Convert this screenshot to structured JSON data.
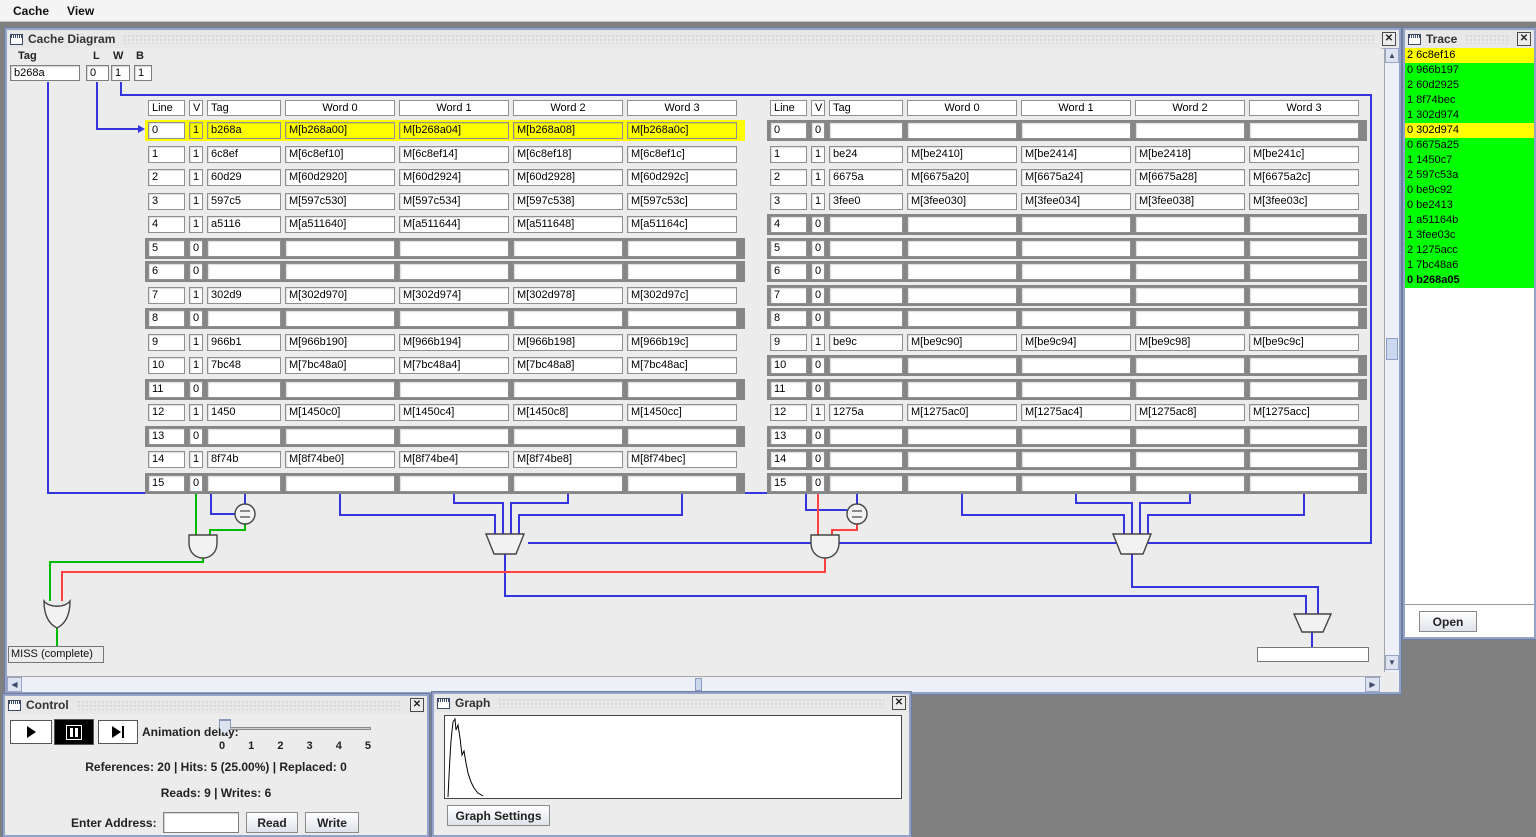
{
  "menu": {
    "items": [
      {
        "label": "Cache"
      },
      {
        "label": "View"
      }
    ]
  },
  "cache_frame": {
    "title": "Cache Diagram",
    "address_fields": {
      "tag_label": "Tag",
      "tag_value": "b268a",
      "line_label": "L",
      "line_value": "0",
      "word_label": "W",
      "word_value": "1",
      "byte_label": "B",
      "byte_value": "1"
    },
    "column_headers": [
      "Line",
      "V",
      "Tag",
      "Word 0",
      "Word 1",
      "Word 2",
      "Word 3"
    ],
    "ways": [
      {
        "rows": [
          {
            "line": "0",
            "v": "1",
            "tag": "b268a",
            "words": [
              "M[b268a00]",
              "M[b268a04]",
              "M[b268a08]",
              "M[b268a0c]"
            ],
            "state": "hit"
          },
          {
            "line": "1",
            "v": "1",
            "tag": "6c8ef",
            "words": [
              "M[6c8ef10]",
              "M[6c8ef14]",
              "M[6c8ef18]",
              "M[6c8ef1c]"
            ],
            "state": "valid"
          },
          {
            "line": "2",
            "v": "1",
            "tag": "60d29",
            "words": [
              "M[60d2920]",
              "M[60d2924]",
              "M[60d2928]",
              "M[60d292c]"
            ],
            "state": "valid"
          },
          {
            "line": "3",
            "v": "1",
            "tag": "597c5",
            "words": [
              "M[597c530]",
              "M[597c534]",
              "M[597c538]",
              "M[597c53c]"
            ],
            "state": "valid"
          },
          {
            "line": "4",
            "v": "1",
            "tag": "a5116",
            "words": [
              "M[a511640]",
              "M[a511644]",
              "M[a511648]",
              "M[a51164c]"
            ],
            "state": "valid"
          },
          {
            "line": "5",
            "v": "0",
            "tag": "",
            "words": [
              "",
              "",
              "",
              ""
            ],
            "state": "empty"
          },
          {
            "line": "6",
            "v": "0",
            "tag": "",
            "words": [
              "",
              "",
              "",
              ""
            ],
            "state": "empty"
          },
          {
            "line": "7",
            "v": "1",
            "tag": "302d9",
            "words": [
              "M[302d970]",
              "M[302d974]",
              "M[302d978]",
              "M[302d97c]"
            ],
            "state": "valid"
          },
          {
            "line": "8",
            "v": "0",
            "tag": "",
            "words": [
              "",
              "",
              "",
              ""
            ],
            "state": "empty"
          },
          {
            "line": "9",
            "v": "1",
            "tag": "966b1",
            "words": [
              "M[966b190]",
              "M[966b194]",
              "M[966b198]",
              "M[966b19c]"
            ],
            "state": "valid"
          },
          {
            "line": "10",
            "v": "1",
            "tag": "7bc48",
            "words": [
              "M[7bc48a0]",
              "M[7bc48a4]",
              "M[7bc48a8]",
              "M[7bc48ac]"
            ],
            "state": "valid"
          },
          {
            "line": "11",
            "v": "0",
            "tag": "",
            "words": [
              "",
              "",
              "",
              ""
            ],
            "state": "empty"
          },
          {
            "line": "12",
            "v": "1",
            "tag": "1450",
            "words": [
              "M[1450c0]",
              "M[1450c4]",
              "M[1450c8]",
              "M[1450cc]"
            ],
            "state": "valid"
          },
          {
            "line": "13",
            "v": "0",
            "tag": "",
            "words": [
              "",
              "",
              "",
              ""
            ],
            "state": "empty"
          },
          {
            "line": "14",
            "v": "1",
            "tag": "8f74b",
            "words": [
              "M[8f74be0]",
              "M[8f74be4]",
              "M[8f74be8]",
              "M[8f74bec]"
            ],
            "state": "valid"
          },
          {
            "line": "15",
            "v": "0",
            "tag": "",
            "words": [
              "",
              "",
              "",
              ""
            ],
            "state": "empty"
          }
        ]
      },
      {
        "rows": [
          {
            "line": "0",
            "v": "0",
            "tag": "",
            "words": [
              "",
              "",
              "",
              ""
            ],
            "state": "empty"
          },
          {
            "line": "1",
            "v": "1",
            "tag": "be24",
            "words": [
              "M[be2410]",
              "M[be2414]",
              "M[be2418]",
              "M[be241c]"
            ],
            "state": "valid"
          },
          {
            "line": "2",
            "v": "1",
            "tag": "6675a",
            "words": [
              "M[6675a20]",
              "M[6675a24]",
              "M[6675a28]",
              "M[6675a2c]"
            ],
            "state": "valid"
          },
          {
            "line": "3",
            "v": "1",
            "tag": "3fee0",
            "words": [
              "M[3fee030]",
              "M[3fee034]",
              "M[3fee038]",
              "M[3fee03c]"
            ],
            "state": "valid"
          },
          {
            "line": "4",
            "v": "0",
            "tag": "",
            "words": [
              "",
              "",
              "",
              ""
            ],
            "state": "empty"
          },
          {
            "line": "5",
            "v": "0",
            "tag": "",
            "words": [
              "",
              "",
              "",
              ""
            ],
            "state": "empty"
          },
          {
            "line": "6",
            "v": "0",
            "tag": "",
            "words": [
              "",
              "",
              "",
              ""
            ],
            "state": "empty"
          },
          {
            "line": "7",
            "v": "0",
            "tag": "",
            "words": [
              "",
              "",
              "",
              ""
            ],
            "state": "empty"
          },
          {
            "line": "8",
            "v": "0",
            "tag": "",
            "words": [
              "",
              "",
              "",
              ""
            ],
            "state": "empty"
          },
          {
            "line": "9",
            "v": "1",
            "tag": "be9c",
            "words": [
              "M[be9c90]",
              "M[be9c94]",
              "M[be9c98]",
              "M[be9c9c]"
            ],
            "state": "valid"
          },
          {
            "line": "10",
            "v": "0",
            "tag": "",
            "words": [
              "",
              "",
              "",
              ""
            ],
            "state": "empty"
          },
          {
            "line": "11",
            "v": "0",
            "tag": "",
            "words": [
              "",
              "",
              "",
              ""
            ],
            "state": "empty"
          },
          {
            "line": "12",
            "v": "1",
            "tag": "1275a",
            "words": [
              "M[1275ac0]",
              "M[1275ac4]",
              "M[1275ac8]",
              "M[1275acc]"
            ],
            "state": "valid"
          },
          {
            "line": "13",
            "v": "0",
            "tag": "",
            "words": [
              "",
              "",
              "",
              ""
            ],
            "state": "empty"
          },
          {
            "line": "14",
            "v": "0",
            "tag": "",
            "words": [
              "",
              "",
              "",
              ""
            ],
            "state": "empty"
          },
          {
            "line": "15",
            "v": "0",
            "tag": "",
            "words": [
              "",
              "",
              "",
              ""
            ],
            "state": "empty"
          }
        ]
      }
    ],
    "miss_status_label": "MISS (complete)",
    "data_output_value": "",
    "wire_colors": {
      "address": "#3535DD",
      "hit": "#00BB00",
      "miss": "#FF4040"
    }
  },
  "trace_frame": {
    "title": "Trace",
    "entries": [
      {
        "text": "2 6c8ef16",
        "color": "#FFFF00",
        "bold": false
      },
      {
        "text": "0 966b197",
        "color": "#00FF00",
        "bold": false
      },
      {
        "text": "2 60d2925",
        "color": "#00FF00",
        "bold": false
      },
      {
        "text": "1 8f74bec",
        "color": "#00FF00",
        "bold": false
      },
      {
        "text": "1 302d974",
        "color": "#00FF00",
        "bold": false
      },
      {
        "text": "0 302d974",
        "color": "#FFFF00",
        "bold": false
      },
      {
        "text": "0 6675a25",
        "color": "#00FF00",
        "bold": false
      },
      {
        "text": "1 1450c7",
        "color": "#00FF00",
        "bold": false
      },
      {
        "text": "2 597c53a",
        "color": "#00FF00",
        "bold": false
      },
      {
        "text": "0 be9c92",
        "color": "#00FF00",
        "bold": false
      },
      {
        "text": "0 be2413",
        "color": "#00FF00",
        "bold": false
      },
      {
        "text": "1 a51164b",
        "color": "#00FF00",
        "bold": false
      },
      {
        "text": "1 3fee03c",
        "color": "#00FF00",
        "bold": false
      },
      {
        "text": "2 1275acc",
        "color": "#00FF00",
        "bold": false
      },
      {
        "text": "1 7bc48a6",
        "color": "#00FF00",
        "bold": false
      },
      {
        "text": "0 b268a05",
        "color": "#00FF00",
        "bold": true
      }
    ],
    "open_button_label": "Open"
  },
  "control_frame": {
    "title": "Control",
    "animation_delay_label": "Animation delay:",
    "slider": {
      "ticks": [
        "0",
        "1",
        "2",
        "3",
        "4",
        "5"
      ],
      "value": 0
    },
    "stats_line1": "References: 20  | Hits: 5 (25.00%)  | Replaced: 0",
    "stats_line2": "Reads: 9 | Writes: 6",
    "enter_address_label": "Enter Address:",
    "address_input_value": "",
    "read_button_label": "Read",
    "write_button_label": "Write"
  },
  "graph_frame": {
    "title": "Graph",
    "settings_button_label": "Graph Settings",
    "curve_points": [
      [
        3,
        81
      ],
      [
        4,
        60
      ],
      [
        5,
        41
      ],
      [
        6,
        25
      ],
      [
        7,
        15
      ],
      [
        8,
        6
      ],
      [
        10,
        3
      ],
      [
        11,
        14
      ],
      [
        13,
        9
      ],
      [
        15,
        22
      ],
      [
        17,
        39
      ],
      [
        19,
        35
      ],
      [
        21,
        47
      ],
      [
        23,
        57
      ],
      [
        26,
        66
      ],
      [
        29,
        72
      ],
      [
        33,
        77
      ],
      [
        38,
        80
      ]
    ]
  }
}
